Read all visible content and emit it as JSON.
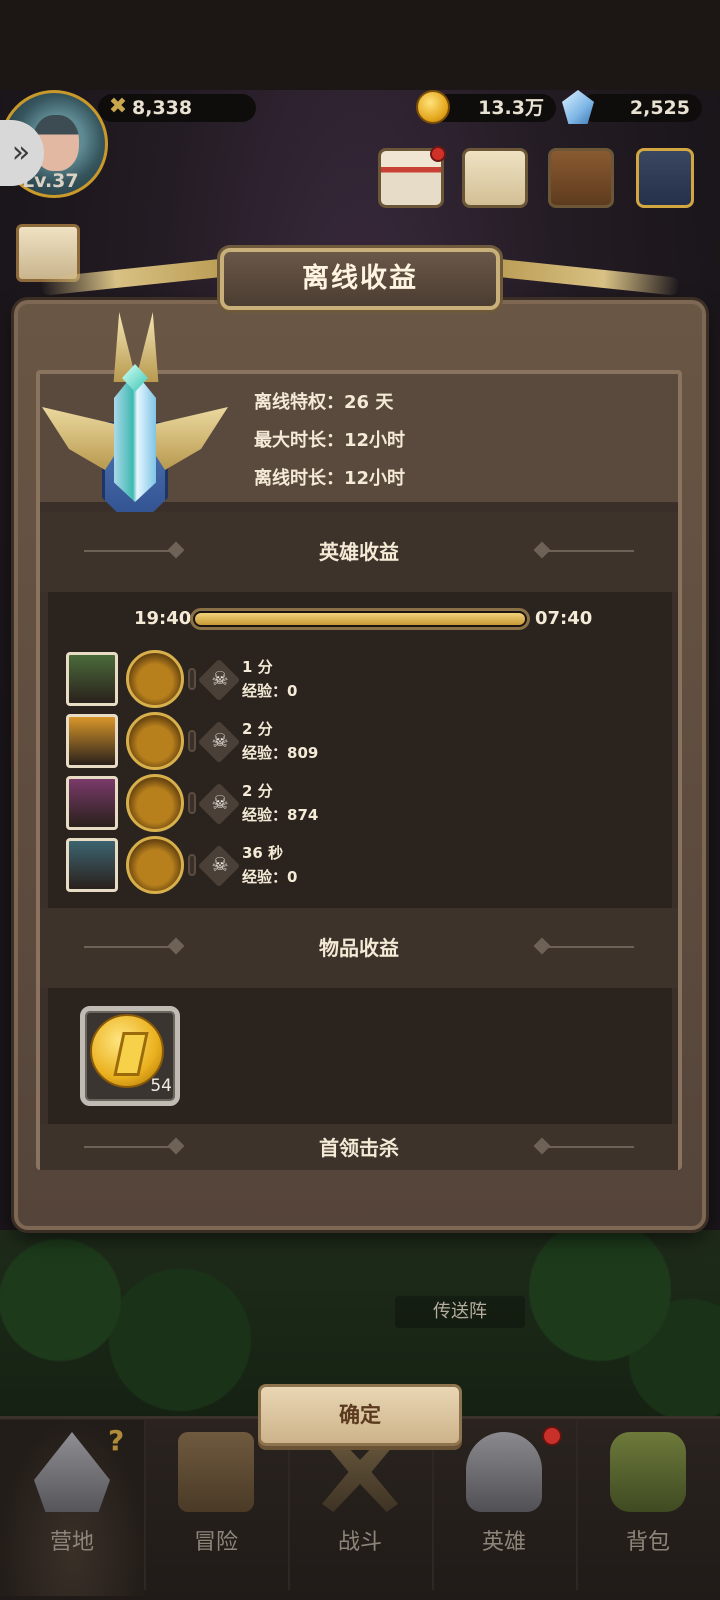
{
  "topbar": {
    "power": "8,338",
    "gold": "13.3万",
    "gems": "2,525",
    "level": "Lv.37",
    "icons": [
      "power-icon",
      "gold-coin-icon",
      "gem-icon",
      "calendar-icon",
      "letter-icon",
      "book-icon",
      "sword-icon",
      "scroll-icon"
    ]
  },
  "modal": {
    "title": "离线收益",
    "info": {
      "privilege": "离线特权：26 天",
      "max_duration": "最大时长：12小时",
      "offline_duration": "离线时长：12小时"
    },
    "hero_section": {
      "title": "英雄收益",
      "time_start": "19:40",
      "time_end": "07:40",
      "progress": 1.0,
      "exp_label": "经验：",
      "heroes": [
        {
          "time": "1 分",
          "exp": "0",
          "portrait_color": "#4a6a3a"
        },
        {
          "time": "2 分",
          "exp": "809",
          "portrait_color": "#d8962a"
        },
        {
          "time": "2 分",
          "exp": "874",
          "portrait_color": "#7a3a6a"
        },
        {
          "time": "36 秒",
          "exp": "0",
          "portrait_color": "#3c6470"
        }
      ]
    },
    "item_section": {
      "title": "物品收益",
      "items": [
        {
          "icon": "gold-coin-icon",
          "count": "54"
        }
      ]
    },
    "boss_section": {
      "title": "首领击杀"
    }
  },
  "scene": {
    "portal_label": "传送阵"
  },
  "confirm_label": "确定",
  "bottom_nav": {
    "items": [
      {
        "label": "营地",
        "icon": "camp-icon",
        "selected": true
      },
      {
        "label": "冒险",
        "icon": "map-icon",
        "selected": false
      },
      {
        "label": "战斗",
        "icon": "battle-icon",
        "selected": false
      },
      {
        "label": "英雄",
        "icon": "hero-helmet-icon",
        "selected": false
      },
      {
        "label": "背包",
        "icon": "backpack-icon",
        "selected": false
      }
    ]
  }
}
